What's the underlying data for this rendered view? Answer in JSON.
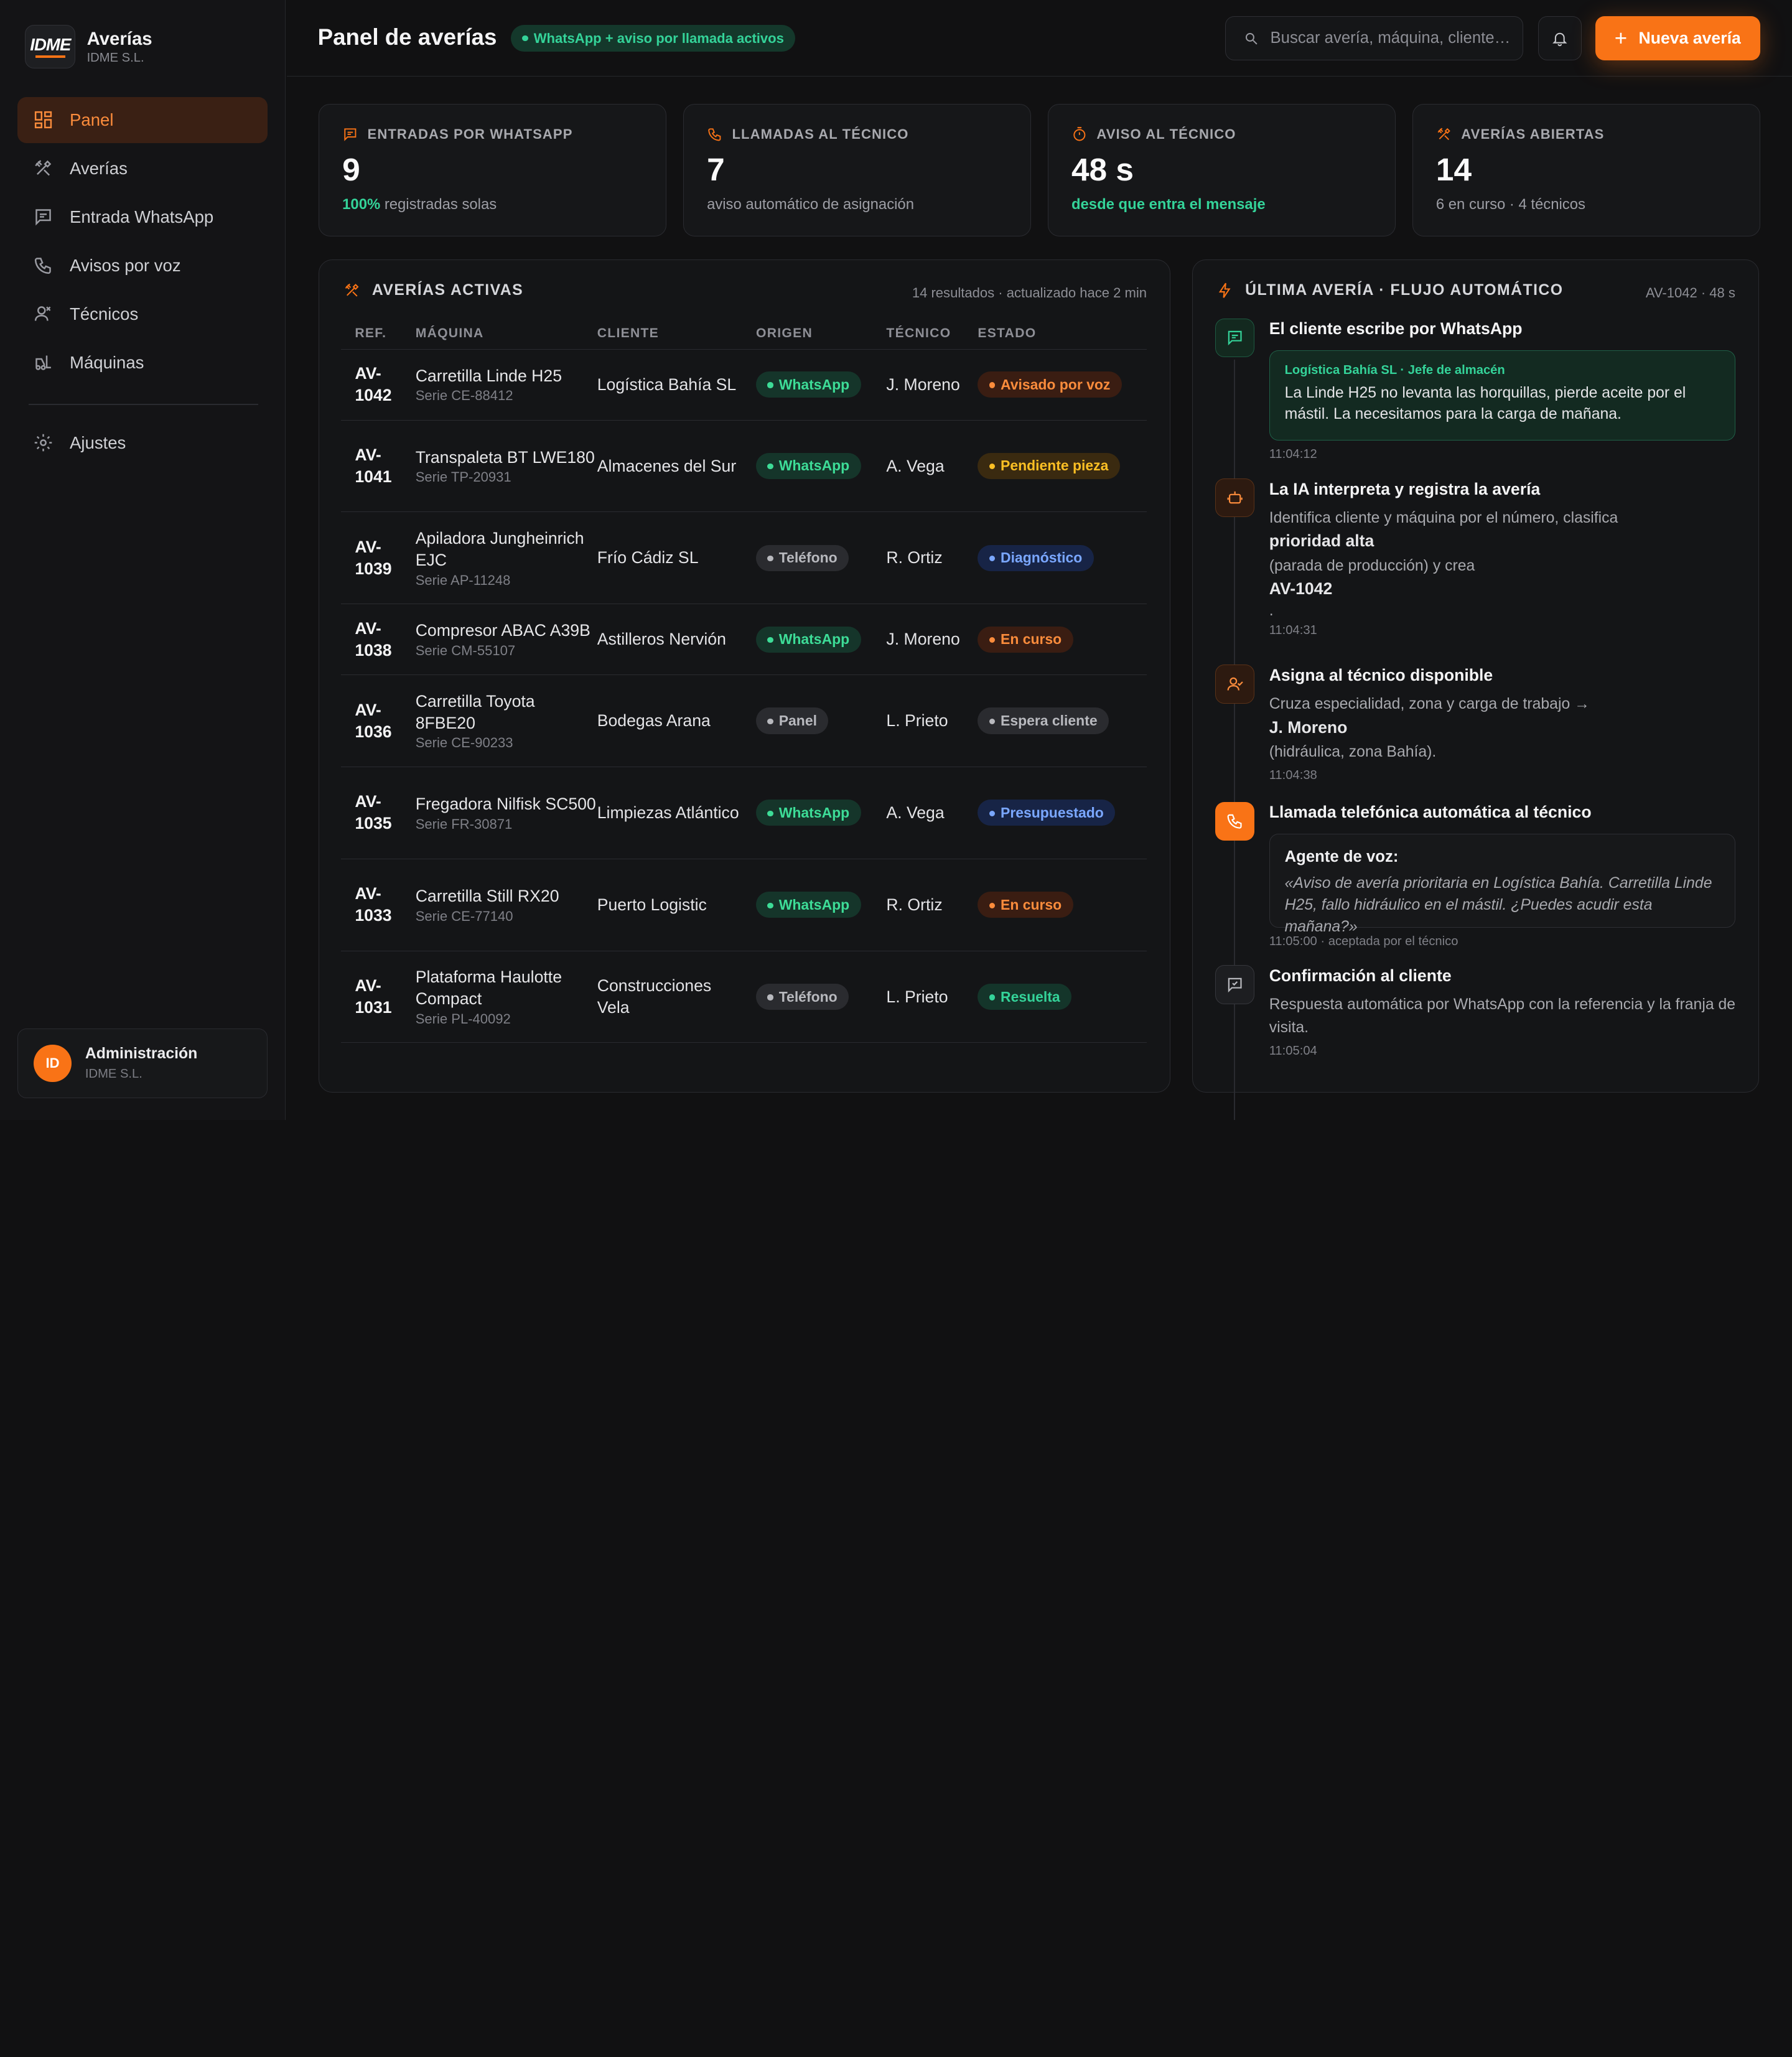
{
  "brand": {
    "logo_text": "IDME",
    "title": "Averías",
    "subtitle": "IDME S.L."
  },
  "nav": [
    {
      "label": "Panel",
      "icon": "dashboard-icon",
      "active": true
    },
    {
      "label": "Averías",
      "icon": "tools-icon"
    },
    {
      "label": "Entrada WhatsApp",
      "icon": "message-icon"
    },
    {
      "label": "Avisos por voz",
      "icon": "phone-icon"
    },
    {
      "label": "Técnicos",
      "icon": "technician-icon"
    },
    {
      "label": "Máquinas",
      "icon": "forklift-icon"
    }
  ],
  "nav_settings": {
    "label": "Ajustes",
    "icon": "gear-icon"
  },
  "user": {
    "initials": "ID",
    "name": "Administración",
    "org": "IDME S.L."
  },
  "header": {
    "title": "Panel de averías",
    "status": "WhatsApp + aviso por llamada activos",
    "search_placeholder": "Buscar avería, máquina, cliente…",
    "new_button": "Nueva avería"
  },
  "kpis": [
    {
      "label": "ENTRADAS POR WHATSAPP",
      "value": "9",
      "sub_highlight": "100%",
      "sub": " registradas solas"
    },
    {
      "label": "LLAMADAS AL TÉCNICO",
      "value": "7",
      "sub_highlight": "",
      "sub": "aviso automático de asignación"
    },
    {
      "label": "AVISO AL TÉCNICO",
      "value": "48 s",
      "sub_highlight": "desde que entra el mensaje",
      "sub": ""
    },
    {
      "label": "AVERÍAS ABIERTAS",
      "value": "14",
      "sub_highlight": "",
      "sub": "6 en curso · 4 técnicos"
    }
  ],
  "table": {
    "title": "AVERÍAS ACTIVAS",
    "meta": "14 resultados · actualizado hace 2 min",
    "columns": [
      "REF.",
      "MÁQUINA",
      "CLIENTE",
      "ORIGEN",
      "TÉCNICO",
      "ESTADO"
    ],
    "rows": [
      {
        "ref": "AV-1042",
        "machine": "Carretilla Linde H25",
        "serial": "Serie CE-88412",
        "client": "Logística Bahía SL",
        "origin": "WhatsApp",
        "tech": "J. Moreno",
        "status": "Avisado por voz",
        "status_color": "orange"
      },
      {
        "ref": "AV-1041",
        "machine": "Transpaleta BT LWE180",
        "serial": "Serie TP-20931",
        "client": "Almacenes del Sur",
        "origin": "WhatsApp",
        "tech": "A. Vega",
        "status": "Pendiente pieza",
        "status_color": "amber"
      },
      {
        "ref": "AV-1039",
        "machine": "Apiladora Jungheinrich EJC",
        "serial": "Serie AP-11248",
        "client": "Frío Cádiz SL",
        "origin": "Teléfono",
        "tech": "R. Ortiz",
        "status": "Diagnóstico",
        "status_color": "blue"
      },
      {
        "ref": "AV-1038",
        "machine": "Compresor ABAC A39B",
        "serial": "Serie CM-55107",
        "client": "Astilleros Nervión",
        "origin": "WhatsApp",
        "tech": "J. Moreno",
        "status": "En curso",
        "status_color": "orange"
      },
      {
        "ref": "AV-1036",
        "machine": "Carretilla Toyota 8FBE20",
        "serial": "Serie CE-90233",
        "client": "Bodegas Arana",
        "origin": "Panel",
        "tech": "L. Prieto",
        "status": "Espera cliente",
        "status_color": "gray"
      },
      {
        "ref": "AV-1035",
        "machine": "Fregadora Nilfisk SC500",
        "serial": "Serie FR-30871",
        "client": "Limpiezas Atlántico",
        "origin": "WhatsApp",
        "tech": "A. Vega",
        "status": "Presupuestado",
        "status_color": "blue"
      },
      {
        "ref": "AV-1033",
        "machine": "Carretilla Still RX20",
        "serial": "Serie CE-77140",
        "client": "Puerto Logistic",
        "origin": "WhatsApp",
        "tech": "R. Ortiz",
        "status": "En curso",
        "status_color": "orange"
      },
      {
        "ref": "AV-1031",
        "machine": "Plataforma Haulotte Compact",
        "serial": "Serie PL-40092",
        "client": "Construcciones Vela",
        "origin": "Teléfono",
        "tech": "L. Prieto",
        "status": "Resuelta",
        "status_color": "green"
      }
    ]
  },
  "flow": {
    "title": "ÚLTIMA AVERÍA · FLUJO AUTOMÁTICO",
    "meta": "AV-1042 · 48 s",
    "step1": {
      "title": "El cliente escribe por WhatsApp",
      "who": "Logística Bahía SL · Jefe de almacén",
      "message": "La Linde H25 no levanta las horquillas, pierde aceite por el mástil. La necesitamos para la carga de mañana.",
      "time": "11:04:12"
    },
    "step2": {
      "title": "La IA interpreta y registra la avería",
      "text1": "Identifica cliente y máquina por el número, clasifica",
      "bold1": "prioridad alta",
      "text2": "(parada de producción) y crea",
      "bold2": "AV-1042",
      "text3": ".",
      "time": "11:04:31"
    },
    "step3": {
      "title": "Asigna al técnico disponible",
      "text1": "Cruza especialidad, zona y carga de trabajo →",
      "bold1": "J. Moreno",
      "text2": "(hidráulica, zona Bahía).",
      "time": "11:04:38"
    },
    "step4": {
      "title": "Llamada telefónica automática al técnico",
      "who": "Agente de voz:",
      "message": "«Aviso de avería prioritaria en Logística Bahía. Carretilla Linde H25, fallo hidráulico en el mástil. ¿Puedes acudir esta mañana?»",
      "time": "11:05:00 · aceptada por el técnico"
    },
    "step5": {
      "title": "Confirmación al cliente",
      "text": "Respuesta automática por WhatsApp con la referencia y la franja de visita.",
      "time": "11:05:04"
    }
  }
}
